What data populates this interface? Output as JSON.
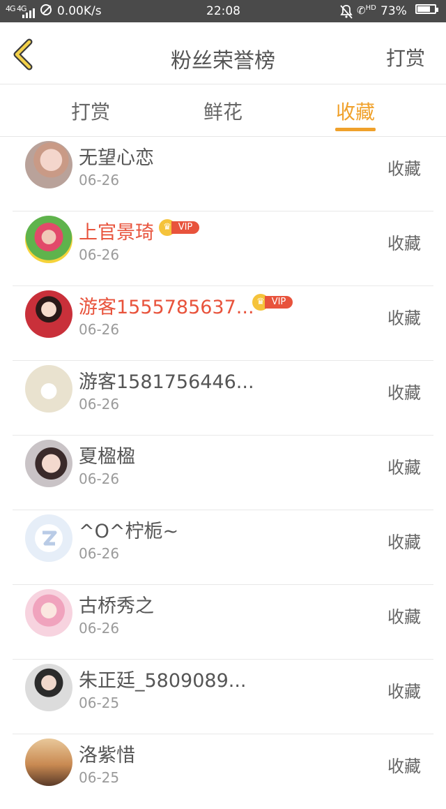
{
  "status_bar": {
    "network": "4G 4G",
    "speed": "0.00K/s",
    "time": "22:08",
    "hd": "HD",
    "battery": "73%"
  },
  "header": {
    "title": "粉丝荣誉榜",
    "right_action": "打赏"
  },
  "tabs": [
    {
      "label": "打赏",
      "active": false
    },
    {
      "label": "鲜花",
      "active": false
    },
    {
      "label": "收藏",
      "active": true
    }
  ],
  "colors": {
    "accent": "#f0a12b",
    "vip_name": "#e8533c"
  },
  "fans": [
    {
      "name": "无望心恋",
      "date": "06-26",
      "action": "收藏",
      "vip": false,
      "avatar": "avatar-girl-pink"
    },
    {
      "name": "上官景琦",
      "date": "06-26",
      "action": "收藏",
      "vip": true,
      "vip_label": "VIP",
      "avatar": "avatar-colorful"
    },
    {
      "name": "游客1555785637...",
      "date": "06-26",
      "action": "收藏",
      "vip": true,
      "vip_label": "VIP",
      "avatar": "avatar-red-dress"
    },
    {
      "name": "游客1581756446...",
      "date": "06-26",
      "action": "收藏",
      "vip": false,
      "avatar": "avatar-cartoon"
    },
    {
      "name": "夏楹楹",
      "date": "06-26",
      "action": "收藏",
      "vip": false,
      "avatar": "avatar-glasses"
    },
    {
      "name": "^O^柠栀~",
      "date": "06-26",
      "action": "收藏",
      "vip": false,
      "avatar": "avatar-qq-default"
    },
    {
      "name": "古桥秀之",
      "date": "06-26",
      "action": "收藏",
      "vip": false,
      "avatar": "avatar-anime"
    },
    {
      "name": "朱正廷_5809089...",
      "date": "06-25",
      "action": "收藏",
      "vip": false,
      "avatar": "avatar-man"
    },
    {
      "name": "洛紫惜",
      "date": "06-25",
      "action": "收藏",
      "vip": false,
      "avatar": "avatar-sunset"
    }
  ]
}
